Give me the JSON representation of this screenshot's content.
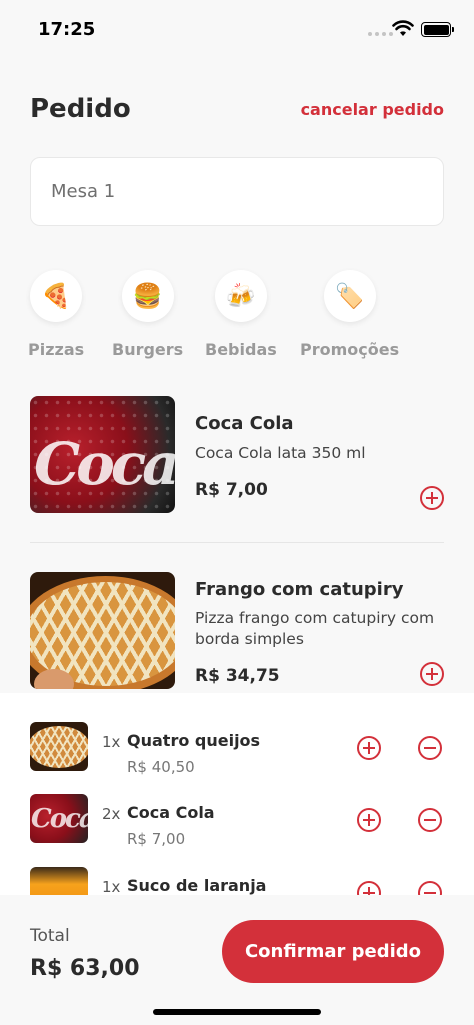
{
  "status_bar": {
    "time": "17:25"
  },
  "header": {
    "title": "Pedido",
    "cancel_label": "cancelar pedido"
  },
  "table_input": {
    "placeholder": "Mesa 1",
    "value": ""
  },
  "categories": [
    {
      "label": "Pizzas",
      "icon": "pizza-icon"
    },
    {
      "label": "Burgers",
      "icon": "burger-icon"
    },
    {
      "label": "Bebidas",
      "icon": "drinks-icon"
    },
    {
      "label": "Promoções",
      "icon": "tag-icon"
    }
  ],
  "products": [
    {
      "name": "Coca Cola",
      "description": "Coca Cola lata 350 ml",
      "price": "R$ 7,00"
    },
    {
      "name": "Frango com catupiry",
      "description": "Pizza frango com catupiry com borda simples",
      "price": "R$ 34,75"
    }
  ],
  "cart": [
    {
      "qty": "1x",
      "name": "Quatro queijos",
      "price": "R$ 40,50"
    },
    {
      "qty": "2x",
      "name": "Coca Cola",
      "price": "R$ 7,00"
    },
    {
      "qty": "1x",
      "name": "Suco de laranja",
      "price": ""
    }
  ],
  "footer": {
    "total_label": "Total",
    "total_value": "R$ 63,00",
    "confirm_label": "Confirmar pedido"
  },
  "colors": {
    "accent": "#d3303a",
    "background": "#f8f8f8",
    "text": "#2b2b2b"
  }
}
